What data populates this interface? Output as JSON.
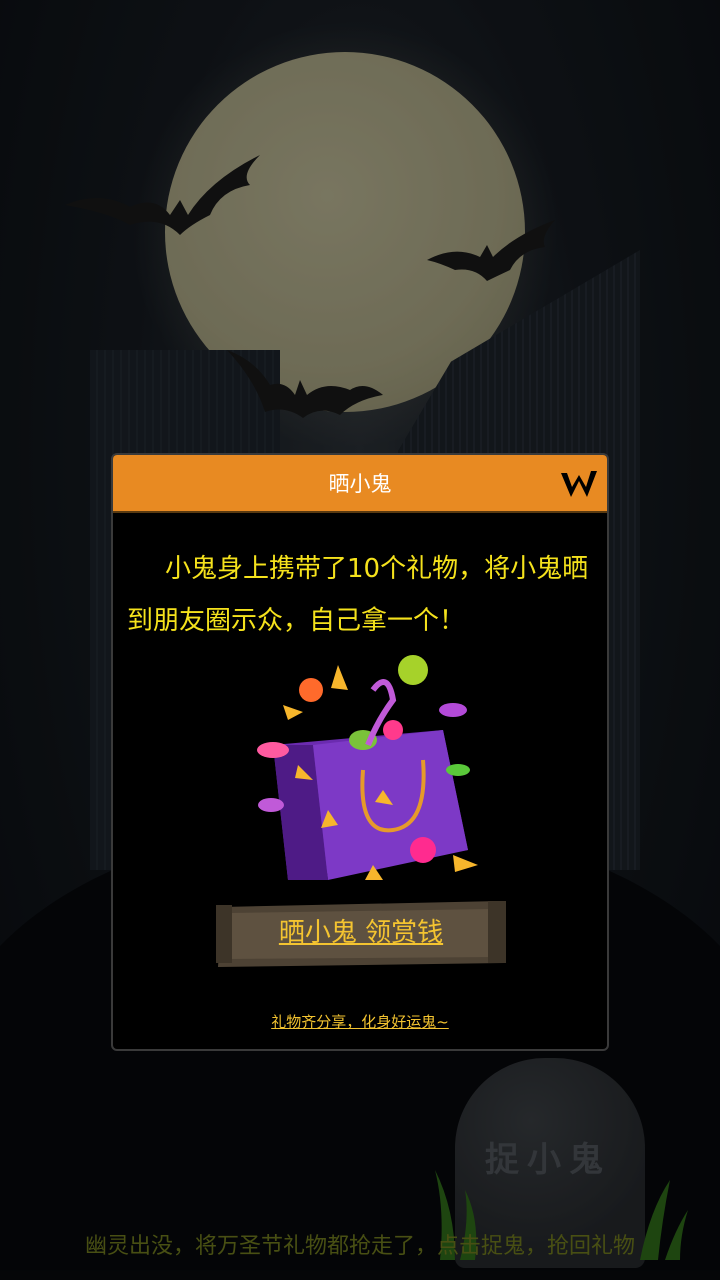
{
  "dialog": {
    "title": "晒小鬼",
    "message": "小鬼身上携带了10个礼物，将小鬼晒到朋友圈示众，自己拿一个！",
    "action_label": "晒小鬼 领赏钱",
    "share_link": "礼物齐分享，化身好运鬼~"
  },
  "background": {
    "tombstone_text": "捉小鬼",
    "caption": "幽灵出没，将万圣节礼物都抢走了，点击捉鬼，抢回礼物"
  },
  "colors": {
    "header": "#e88a22",
    "message_text": "#f5e21c",
    "link_text": "#f4c430",
    "caption_text": "#6f7a1e"
  },
  "icons": {
    "close": "close-x-icon",
    "gift": "candy-bag-icon"
  }
}
